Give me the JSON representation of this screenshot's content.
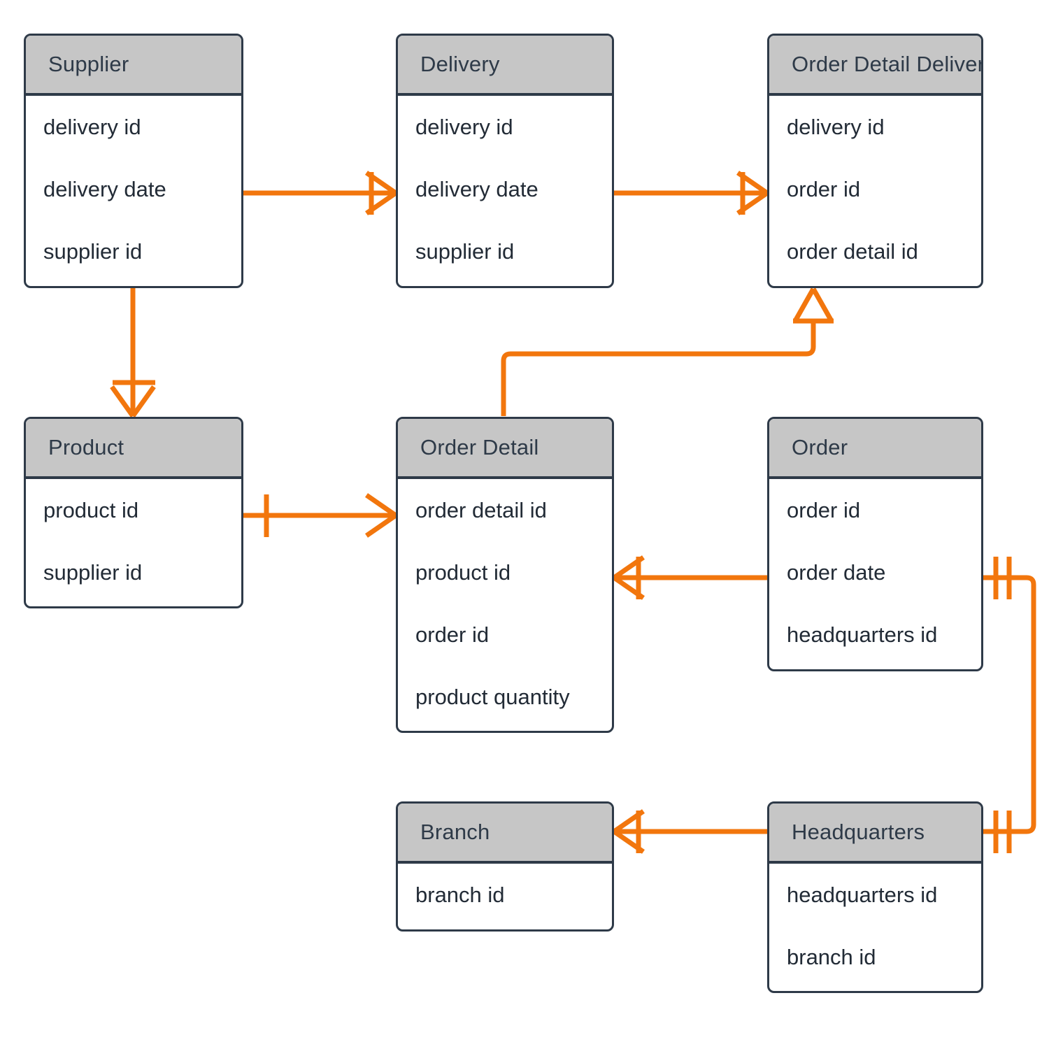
{
  "diagram": {
    "type": "entity-relationship-diagram",
    "notation": "crow's foot",
    "background": "#ffffff",
    "entity_header_fill": "#c6c6c6",
    "entity_border_color": "#2e3a48",
    "relationship_line_color": "#f2760d"
  },
  "entities": [
    {
      "id": "supplier",
      "name": "Supplier",
      "attributes": [
        "delivery id",
        "delivery date",
        "supplier id"
      ]
    },
    {
      "id": "delivery",
      "name": "Delivery",
      "attributes": [
        "delivery id",
        "delivery date",
        "supplier id"
      ]
    },
    {
      "id": "order_detail_delivery",
      "name": "Order Detail Delivery",
      "attributes": [
        "delivery id",
        "order id",
        "order detail id"
      ]
    },
    {
      "id": "product",
      "name": "Product",
      "attributes": [
        "product id",
        "supplier id"
      ]
    },
    {
      "id": "order_detail",
      "name": "Order Detail",
      "attributes": [
        "order detail id",
        "product id",
        "order id",
        "product quantity"
      ]
    },
    {
      "id": "order",
      "name": "Order",
      "attributes": [
        "order id",
        "order date",
        "headquarters id"
      ]
    },
    {
      "id": "branch",
      "name": "Branch",
      "attributes": [
        "branch id"
      ]
    },
    {
      "id": "headquarters",
      "name": "Headquarters",
      "attributes": [
        "headquarters id",
        "branch id"
      ]
    }
  ],
  "relationships": [
    {
      "id": "supplier-delivery",
      "from": "supplier",
      "to": "delivery",
      "from_cardinality": "one",
      "to_cardinality": "one-to-many"
    },
    {
      "id": "delivery-order-detail-delivery",
      "from": "delivery",
      "to": "order_detail_delivery",
      "from_cardinality": "one",
      "to_cardinality": "one-to-many"
    },
    {
      "id": "supplier-product",
      "from": "supplier",
      "to": "product",
      "from_cardinality": "one",
      "to_cardinality": "one-to-many"
    },
    {
      "id": "order-detail-delivery-order-detail",
      "from": "order_detail_delivery",
      "to": "order_detail",
      "from_cardinality": "one-to-many",
      "to_cardinality": "one"
    },
    {
      "id": "product-order-detail",
      "from": "product",
      "to": "order_detail",
      "from_cardinality": "one",
      "to_cardinality": "one-to-many"
    },
    {
      "id": "order-detail-order",
      "from": "order_detail",
      "to": "order",
      "from_cardinality": "one-to-many",
      "to_cardinality": "one"
    },
    {
      "id": "branch-headquarters",
      "from": "branch",
      "to": "headquarters",
      "from_cardinality": "one-to-many",
      "to_cardinality": "one"
    },
    {
      "id": "order-headquarters",
      "from": "order",
      "to": "headquarters",
      "from_cardinality": "exactly-one",
      "to_cardinality": "exactly-one"
    }
  ]
}
